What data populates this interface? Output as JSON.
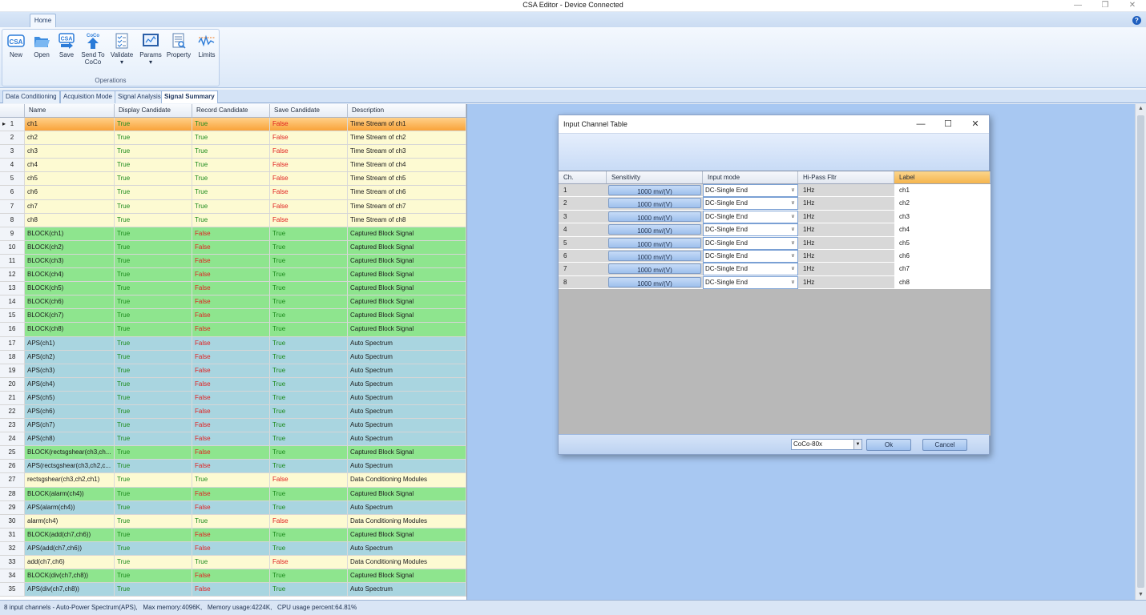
{
  "window": {
    "title": "CSA Editor - Device Connected",
    "controls": [
      "—",
      "❐",
      "✕"
    ]
  },
  "ribbon": {
    "tab": "Home",
    "group_label": "Operations",
    "buttons": [
      {
        "label": "New",
        "icon": "csa-new-icon"
      },
      {
        "label": "Open",
        "icon": "folder-open-icon"
      },
      {
        "label": "Save",
        "icon": "csa-save-icon"
      },
      {
        "label": "Send To",
        "label2": "CoCo",
        "icon": "send-to-coco-icon"
      },
      {
        "label": "Validate",
        "icon": "validate-icon"
      },
      {
        "label": "Params",
        "icon": "params-icon"
      },
      {
        "label": "Property",
        "icon": "property-icon"
      },
      {
        "label": "Limits",
        "icon": "limits-icon"
      }
    ],
    "icon_labels": {
      "csa": "CSA",
      "coco": "CoCo"
    }
  },
  "doc_tabs": [
    "Data Conditioning",
    "Acquisition Mode",
    "Signal Analysis",
    "Signal Summary"
  ],
  "grid": {
    "headers": [
      "Name",
      "Display Candidate",
      "Record Candidate",
      "Save Candidate",
      "Description"
    ],
    "selected_marker": "▸",
    "rows": [
      {
        "n": "1",
        "name": "ch1",
        "disp": "True",
        "rec": "True",
        "save": "False",
        "desc": "Time Stream of ch1",
        "kind": "sel"
      },
      {
        "n": "2",
        "name": "ch2",
        "disp": "True",
        "rec": "True",
        "save": "False",
        "desc": "Time Stream of ch2",
        "kind": "ts"
      },
      {
        "n": "3",
        "name": "ch3",
        "disp": "True",
        "rec": "True",
        "save": "False",
        "desc": "Time Stream of ch3",
        "kind": "ts"
      },
      {
        "n": "4",
        "name": "ch4",
        "disp": "True",
        "rec": "True",
        "save": "False",
        "desc": "Time Stream of ch4",
        "kind": "ts"
      },
      {
        "n": "5",
        "name": "ch5",
        "disp": "True",
        "rec": "True",
        "save": "False",
        "desc": "Time Stream of ch5",
        "kind": "ts"
      },
      {
        "n": "6",
        "name": "ch6",
        "disp": "True",
        "rec": "True",
        "save": "False",
        "desc": "Time Stream of ch6",
        "kind": "ts"
      },
      {
        "n": "7",
        "name": "ch7",
        "disp": "True",
        "rec": "True",
        "save": "False",
        "desc": "Time Stream of ch7",
        "kind": "ts"
      },
      {
        "n": "8",
        "name": "ch8",
        "disp": "True",
        "rec": "True",
        "save": "False",
        "desc": "Time Stream of ch8",
        "kind": "ts"
      },
      {
        "n": "9",
        "name": "BLOCK(ch1)",
        "disp": "True",
        "rec": "False",
        "save": "True",
        "desc": "Captured Block Signal",
        "kind": "blk"
      },
      {
        "n": "10",
        "name": "BLOCK(ch2)",
        "disp": "True",
        "rec": "False",
        "save": "True",
        "desc": "Captured Block Signal",
        "kind": "blk"
      },
      {
        "n": "11",
        "name": "BLOCK(ch3)",
        "disp": "True",
        "rec": "False",
        "save": "True",
        "desc": "Captured Block Signal",
        "kind": "blk"
      },
      {
        "n": "12",
        "name": "BLOCK(ch4)",
        "disp": "True",
        "rec": "False",
        "save": "True",
        "desc": "Captured Block Signal",
        "kind": "blk"
      },
      {
        "n": "13",
        "name": "BLOCK(ch5)",
        "disp": "True",
        "rec": "False",
        "save": "True",
        "desc": "Captured Block Signal",
        "kind": "blk"
      },
      {
        "n": "14",
        "name": "BLOCK(ch6)",
        "disp": "True",
        "rec": "False",
        "save": "True",
        "desc": "Captured Block Signal",
        "kind": "blk"
      },
      {
        "n": "15",
        "name": "BLOCK(ch7)",
        "disp": "True",
        "rec": "False",
        "save": "True",
        "desc": "Captured Block Signal",
        "kind": "blk"
      },
      {
        "n": "16",
        "name": "BLOCK(ch8)",
        "disp": "True",
        "rec": "False",
        "save": "True",
        "desc": "Captured Block Signal",
        "kind": "blk"
      },
      {
        "n": "17",
        "name": "APS(ch1)",
        "disp": "True",
        "rec": "False",
        "save": "True",
        "desc": "Auto Spectrum",
        "kind": "aps"
      },
      {
        "n": "18",
        "name": "APS(ch2)",
        "disp": "True",
        "rec": "False",
        "save": "True",
        "desc": "Auto Spectrum",
        "kind": "aps"
      },
      {
        "n": "19",
        "name": "APS(ch3)",
        "disp": "True",
        "rec": "False",
        "save": "True",
        "desc": "Auto Spectrum",
        "kind": "aps"
      },
      {
        "n": "20",
        "name": "APS(ch4)",
        "disp": "True",
        "rec": "False",
        "save": "True",
        "desc": "Auto Spectrum",
        "kind": "aps"
      },
      {
        "n": "21",
        "name": "APS(ch5)",
        "disp": "True",
        "rec": "False",
        "save": "True",
        "desc": "Auto Spectrum",
        "kind": "aps"
      },
      {
        "n": "22",
        "name": "APS(ch6)",
        "disp": "True",
        "rec": "False",
        "save": "True",
        "desc": "Auto Spectrum",
        "kind": "aps"
      },
      {
        "n": "23",
        "name": "APS(ch7)",
        "disp": "True",
        "rec": "False",
        "save": "True",
        "desc": "Auto Spectrum",
        "kind": "aps"
      },
      {
        "n": "24",
        "name": "APS(ch8)",
        "disp": "True",
        "rec": "False",
        "save": "True",
        "desc": "Auto Spectrum",
        "kind": "aps"
      },
      {
        "n": "25",
        "name": "BLOCK(rectsgshear(ch3,ch...",
        "disp": "True",
        "rec": "False",
        "save": "True",
        "desc": "Captured Block Signal",
        "kind": "blk"
      },
      {
        "n": "26",
        "name": "APS(rectsgshear(ch3,ch2,c...",
        "disp": "True",
        "rec": "False",
        "save": "True",
        "desc": "Auto Spectrum",
        "kind": "aps"
      },
      {
        "n": "27",
        "name": "rectsgshear(ch3,ch2,ch1)",
        "disp": "True",
        "rec": "True",
        "save": "False",
        "desc": "Data Conditioning Modules",
        "kind": "ts"
      },
      {
        "n": "28",
        "name": "BLOCK(alarm(ch4))",
        "disp": "True",
        "rec": "False",
        "save": "True",
        "desc": "Captured Block Signal",
        "kind": "blk"
      },
      {
        "n": "29",
        "name": "APS(alarm(ch4))",
        "disp": "True",
        "rec": "False",
        "save": "True",
        "desc": "Auto Spectrum",
        "kind": "aps"
      },
      {
        "n": "30",
        "name": "alarm(ch4)",
        "disp": "True",
        "rec": "True",
        "save": "False",
        "desc": "Data Conditioning Modules",
        "kind": "ts"
      },
      {
        "n": "31",
        "name": "BLOCK(add(ch7,ch6))",
        "disp": "True",
        "rec": "False",
        "save": "True",
        "desc": "Captured Block Signal",
        "kind": "blk"
      },
      {
        "n": "32",
        "name": "APS(add(ch7,ch6))",
        "disp": "True",
        "rec": "False",
        "save": "True",
        "desc": "Auto Spectrum",
        "kind": "aps"
      },
      {
        "n": "33",
        "name": "add(ch7,ch6)",
        "disp": "True",
        "rec": "True",
        "save": "False",
        "desc": "Data Conditioning Modules",
        "kind": "ts"
      },
      {
        "n": "34",
        "name": "BLOCK(div(ch7,ch8))",
        "disp": "True",
        "rec": "False",
        "save": "True",
        "desc": "Captured Block Signal",
        "kind": "blk"
      },
      {
        "n": "35",
        "name": "APS(div(ch7,ch8))",
        "disp": "True",
        "rec": "False",
        "save": "True",
        "desc": "Auto Spectrum",
        "kind": "aps"
      }
    ]
  },
  "row_colors": {
    "sel": "#ffb347",
    "ts": "#fdfad2",
    "blk": "#8ee58e",
    "aps": "#a9d5e0"
  },
  "dialog": {
    "title": "Input Channel Table",
    "controls": [
      "—",
      "☐",
      "✕"
    ],
    "headers": [
      "Ch.",
      "Sensitivity",
      "Input mode",
      "Hi-Pass Fltr",
      "Label"
    ],
    "rows": [
      {
        "ch": "1",
        "sens": "1000 mv/(V)",
        "mode": "DC-Single End",
        "hp": "1Hz",
        "label": "ch1"
      },
      {
        "ch": "2",
        "sens": "1000 mv/(V)",
        "mode": "DC-Single End",
        "hp": "1Hz",
        "label": "ch2"
      },
      {
        "ch": "3",
        "sens": "1000 mv/(V)",
        "mode": "DC-Single End",
        "hp": "1Hz",
        "label": "ch3"
      },
      {
        "ch": "4",
        "sens": "1000 mv/(V)",
        "mode": "DC-Single End",
        "hp": "1Hz",
        "label": "ch4"
      },
      {
        "ch": "5",
        "sens": "1000 mv/(V)",
        "mode": "DC-Single End",
        "hp": "1Hz",
        "label": "ch5"
      },
      {
        "ch": "6",
        "sens": "1000 mv/(V)",
        "mode": "DC-Single End",
        "hp": "1Hz",
        "label": "ch6"
      },
      {
        "ch": "7",
        "sens": "1000 mv/(V)",
        "mode": "DC-Single End",
        "hp": "1Hz",
        "label": "ch7"
      },
      {
        "ch": "8",
        "sens": "1000 mv/(V)",
        "mode": "DC-Single End",
        "hp": "1Hz",
        "label": "ch8"
      }
    ],
    "device_combo": "CoCo-80x",
    "ok_label": "Ok",
    "cancel_label": "Cancel"
  },
  "status_bar": "8 input channels - Auto-Power Spectrum(APS),   Max memory:4096K,   Memory usage:4224K,   CPU usage percent:64.81%"
}
